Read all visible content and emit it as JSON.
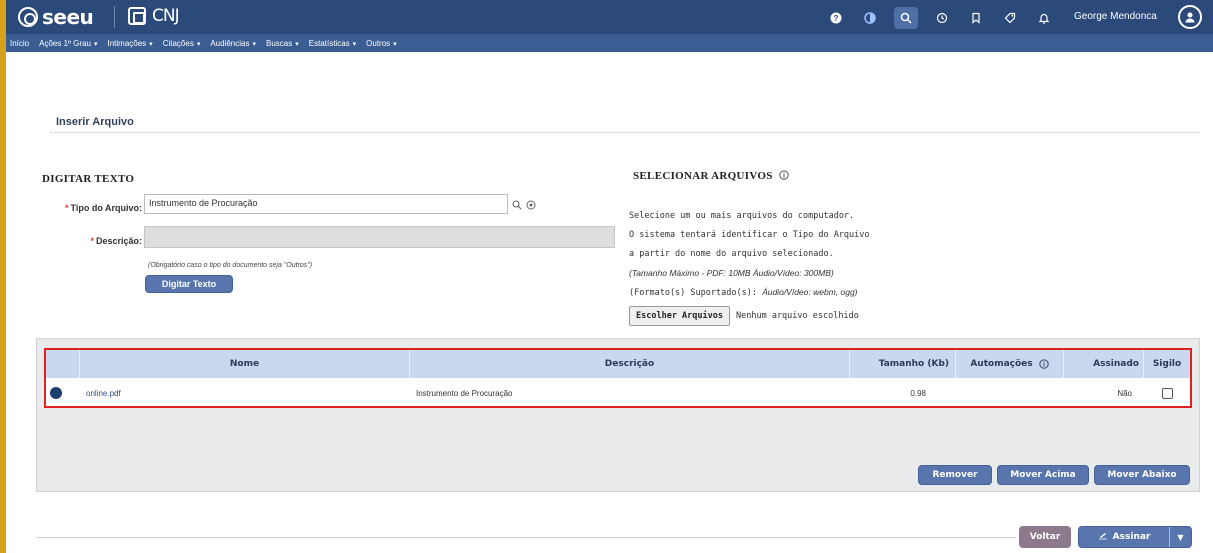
{
  "header": {
    "logo_text": "seeu",
    "cnj_text": "CNJ",
    "user_name": "George Mendonca",
    "icons": [
      "help-icon",
      "contrast-icon",
      "search-icon",
      "history-icon",
      "bookmark-icon",
      "tag-icon",
      "bell-icon"
    ]
  },
  "menu": [
    {
      "label": "Início",
      "caret": false
    },
    {
      "label": "Ações 1º Grau",
      "caret": true
    },
    {
      "label": "Intimações",
      "caret": true
    },
    {
      "label": "Citações",
      "caret": true
    },
    {
      "label": "Audiências",
      "caret": true
    },
    {
      "label": "Buscas",
      "caret": true
    },
    {
      "label": "Estatísticas",
      "caret": true
    },
    {
      "label": "Outros",
      "caret": true
    }
  ],
  "page_title": "Inserir Arquivo",
  "digitar": {
    "heading": "DIGITAR TEXTO",
    "tipo_label": "Tipo do Arquivo:",
    "tipo_value": "Instrumento de Procuração",
    "descricao_label": "Descrição:",
    "descricao_value": "",
    "hint": "(Obrigatório caso o tipo do documento seja \"Outros\")",
    "button": "Digitar Texto"
  },
  "selecionar": {
    "heading": "SELECIONAR ARQUIVOS",
    "line1": "Selecione um ou mais arquivos do computador.",
    "line2": "O sistema tentará identificar o Tipo do Arquivo",
    "line3": "a partir do nome do arquivo selecionado.",
    "line4": "(Tamanho Máximo - PDF: 10MB  Áudio/Vídeo: 300MB)",
    "line5_prefix": "(Formato(s) Suportado(s):",
    "line5_italic": "Áudio/Vídeo: webm, ogg)",
    "choose_button": "Escolher Arquivos",
    "no_file": "Nenhum arquivo escolhido"
  },
  "table": {
    "headers": {
      "nome": "Nome",
      "descricao": "Descrição",
      "tamanho": "Tamanho (Kb)",
      "automacoes": "Automações",
      "assinado": "Assinado",
      "sigilo": "Sigilo"
    },
    "rows": [
      {
        "nome": "online.pdf",
        "descricao": "Instrumento de Procuração",
        "tamanho": "0.98",
        "automacoes": "",
        "assinado": "Não"
      }
    ]
  },
  "actions": {
    "remover": "Remover",
    "mover_acima": "Mover Acima",
    "mover_abaixo": "Mover Abaixo"
  },
  "footer": {
    "voltar": "Voltar",
    "assinar": "Assinar"
  },
  "colors": {
    "header_bg": "#2b4a7a",
    "menu_bg": "#3a5d93",
    "button_blue": "#5876ad",
    "highlight_red": "#e02020",
    "left_accent": "#d6a21e"
  }
}
